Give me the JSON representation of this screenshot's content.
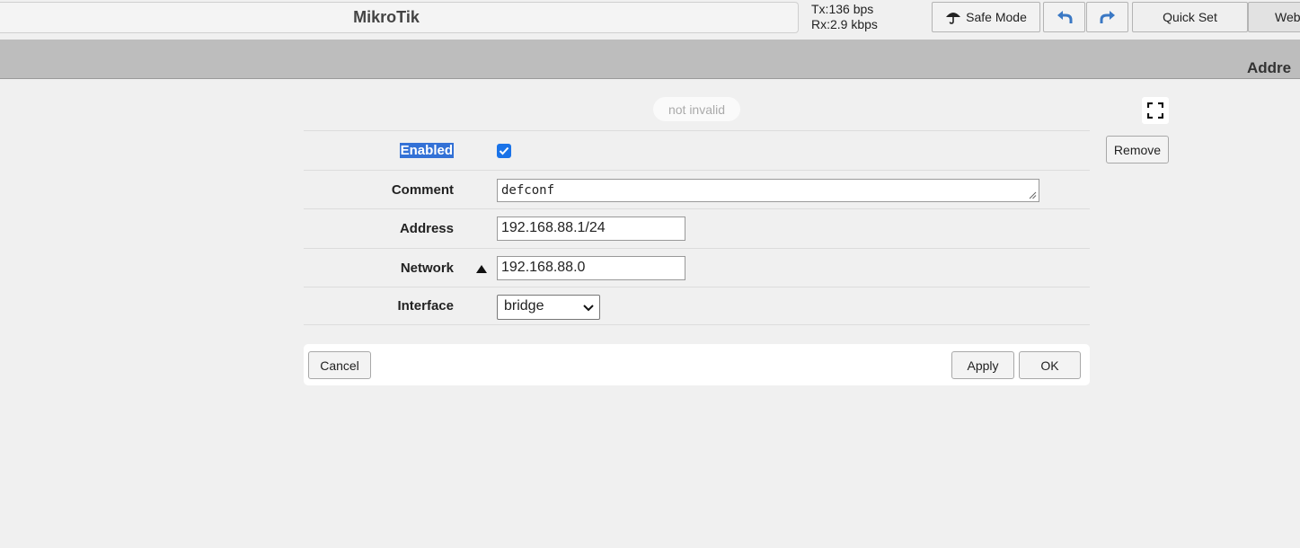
{
  "topbar": {
    "brand": "MikroTik",
    "tx": "Tx:136 bps",
    "rx": "Rx:2.9 kbps",
    "safe_mode_label": "Safe Mode",
    "quick_set_label": "Quick Set",
    "webfig_label": "Web"
  },
  "title_band": {
    "title": "Addre"
  },
  "form": {
    "status": "not invalid",
    "remove_label": "Remove",
    "enabled": {
      "label": "Enabled",
      "checked": true
    },
    "comment": {
      "label": "Comment",
      "value": "defconf"
    },
    "address": {
      "label": "Address",
      "value": "192.168.88.1/24"
    },
    "network": {
      "label": "Network",
      "value": "192.168.88.0"
    },
    "interface": {
      "label": "Interface",
      "value": "bridge"
    }
  },
  "actions": {
    "cancel": "Cancel",
    "apply": "Apply",
    "ok": "OK"
  },
  "colors": {
    "accent": "#1a73e8",
    "selection": "#3371d6",
    "band": "#bdbdbd",
    "background": "#f0f0f0"
  },
  "icons": [
    "umbrella-icon",
    "undo-icon",
    "redo-icon",
    "expand-icon",
    "checkmark-icon",
    "sort-ascending-icon",
    "chevron-down-icon",
    "resize-grip-icon"
  ]
}
